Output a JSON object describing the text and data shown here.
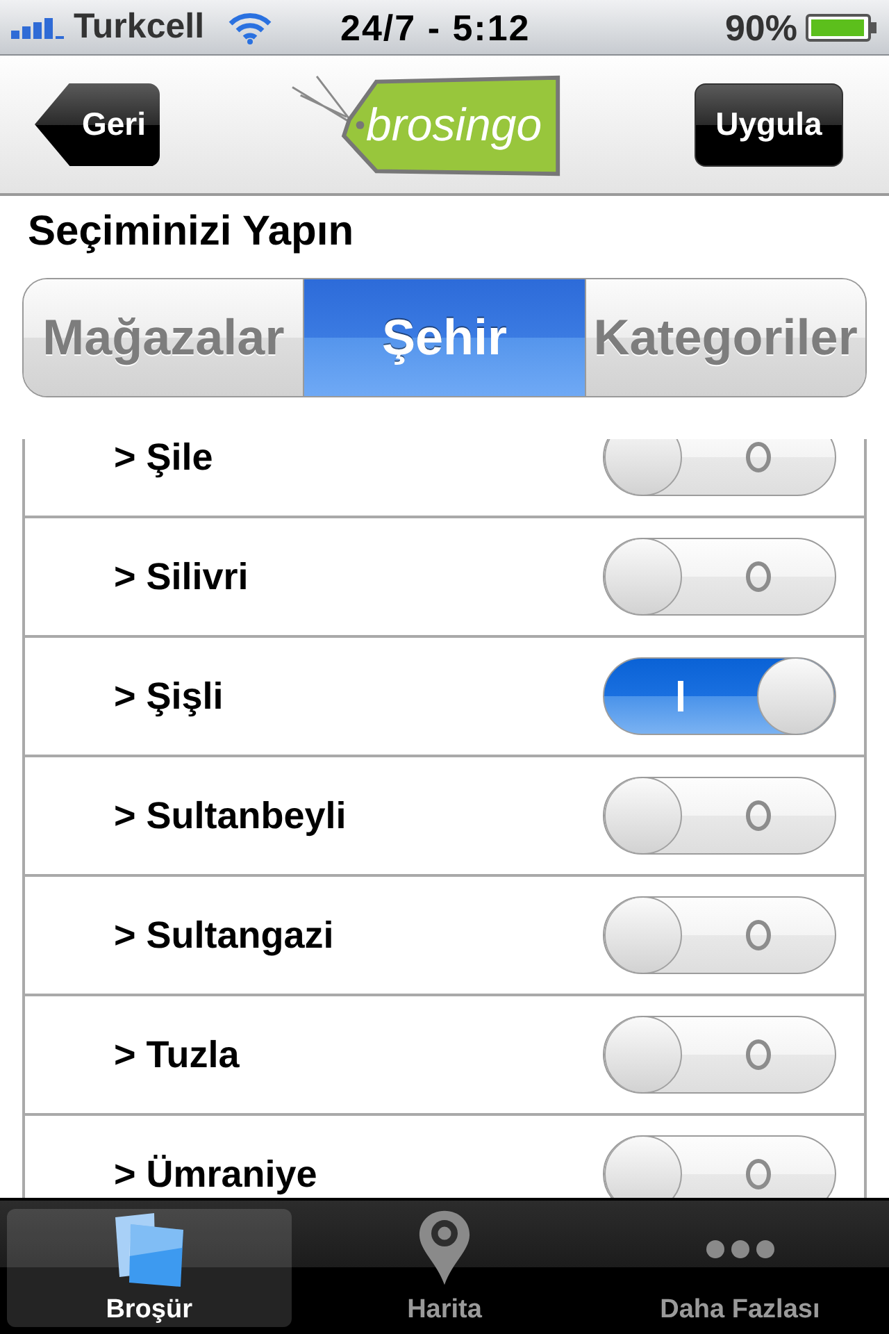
{
  "status_bar": {
    "carrier": "Turkcell",
    "time": "24/7 - 5:12",
    "battery": "90%"
  },
  "nav_bar": {
    "back_button": "Geri",
    "logo": "brosingo",
    "action_button": "Uygula"
  },
  "section_title": "Seçiminizi Yapın",
  "segments": [
    {
      "label": "Mağazalar",
      "selected": false
    },
    {
      "label": "Şehir",
      "selected": true
    },
    {
      "label": "Kategoriler",
      "selected": false
    }
  ],
  "rows": [
    {
      "label": "> Şile",
      "on": false
    },
    {
      "label": "> Silivri",
      "on": false
    },
    {
      "label": "> Şişli",
      "on": true
    },
    {
      "label": "> Sultanbeyli",
      "on": false
    },
    {
      "label": "> Sultangazi",
      "on": false
    },
    {
      "label": "> Tuzla",
      "on": false
    },
    {
      "label": "> Ümraniye",
      "on": false
    }
  ],
  "tab_bar": [
    {
      "label": "Broşür",
      "kind": "brochure",
      "selected": true
    },
    {
      "label": "Harita",
      "kind": "map",
      "selected": false
    },
    {
      "label": "Daha Fazlası",
      "kind": "more",
      "selected": false
    }
  ]
}
